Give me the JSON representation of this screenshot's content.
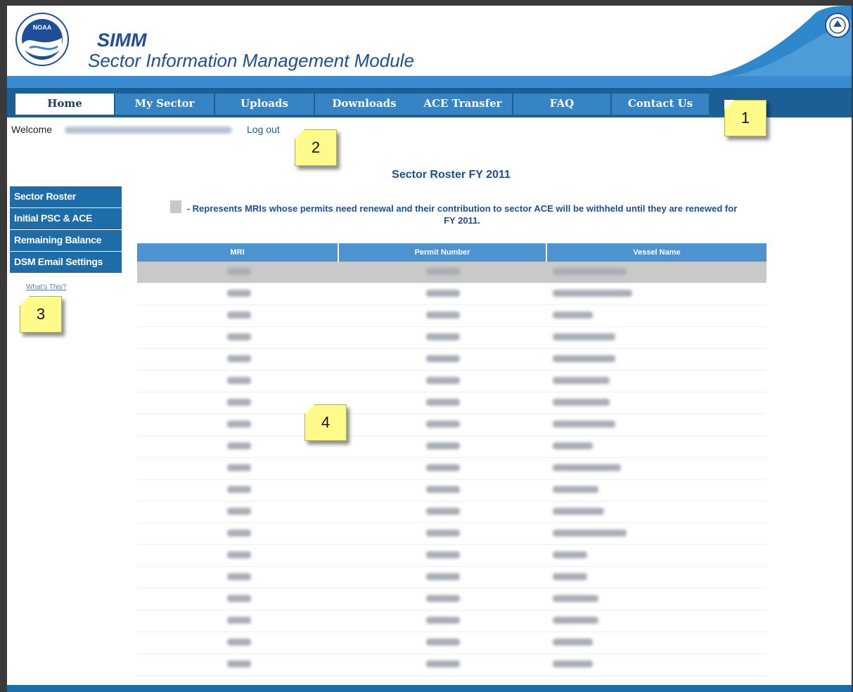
{
  "header": {
    "app_abbr": "SIMM",
    "app_title": "Sector Information Management Module",
    "logo_icon": "noaa-logo-icon",
    "seal_icon": "department-seal-icon",
    "brand_color": "#1c4f98",
    "nav_color": "#1b5f94"
  },
  "nav": {
    "tabs": [
      {
        "label": "Home",
        "active": true
      },
      {
        "label": "My Sector",
        "active": false
      },
      {
        "label": "Uploads",
        "active": false
      },
      {
        "label": "Downloads",
        "active": false
      },
      {
        "label": "ACE Transfer",
        "active": false
      },
      {
        "label": "FAQ",
        "active": false
      },
      {
        "label": "Contact Us",
        "active": false
      }
    ]
  },
  "user": {
    "welcome_label": "Welcome",
    "logout_label": "Log out"
  },
  "sidebar": {
    "items": [
      {
        "label": "Sector Roster"
      },
      {
        "label": "Initial PSC & ACE"
      },
      {
        "label": "Remaining Balance"
      },
      {
        "label": "DSM Email Settings"
      }
    ],
    "whats_this": "What's This?"
  },
  "main": {
    "title": "Sector Roster FY 2011",
    "legend_text": "- Represents MRIs whose permits need renewal and their contribution to sector ACE will be withheld until they are renewed for FY 2011.",
    "legend_swatch_color": "#c8c8c8",
    "table": {
      "columns": [
        "MRI",
        "Permit Number",
        "Vessel Name"
      ],
      "rows": [
        {
          "mri": "0011",
          "permit": "130063",
          "vessel": "KORBERTEOREM",
          "highlight": true
        },
        {
          "mri": "081",
          "permit": "011000",
          "vessel": "SEASTTOCUFILE",
          "highlight": false
        },
        {
          "mri": "070",
          "permit": "113000",
          "vessel": "CDSEBT",
          "highlight": false
        },
        {
          "mri": "089",
          "permit": "333098",
          "vessel": "CATT TRUTE",
          "highlight": false
        },
        {
          "mri": "081",
          "permit": "333307",
          "vessel": "SUSES FROM",
          "highlight": false
        },
        {
          "mri": "069",
          "permit": "320518",
          "vessel": "BALEF SEO",
          "highlight": false
        },
        {
          "mri": "701",
          "permit": "330130",
          "vessel": "C SEETLRS",
          "highlight": false
        },
        {
          "mri": "703",
          "permit": "300013",
          "vessel": "BELCTRSSEE",
          "highlight": false
        },
        {
          "mri": "704",
          "permit": "330191",
          "vessel": "UFSTET",
          "highlight": false
        },
        {
          "mri": "706",
          "permit": "330768",
          "vessel": "SEHES TASEE",
          "highlight": false
        },
        {
          "mri": "708",
          "permit": "300865",
          "vessel": "TSOFEOE",
          "highlight": false
        },
        {
          "mri": "788",
          "permit": "113960",
          "vessel": "LAST ERE",
          "highlight": false
        },
        {
          "mri": "079",
          "permit": "330073",
          "vessel": "BROOET SEDSE",
          "highlight": false
        },
        {
          "mri": "333",
          "permit": "330195",
          "vessel": "SEECR",
          "highlight": false
        },
        {
          "mri": "080",
          "permit": "136911",
          "vessel": "SELTT",
          "highlight": false
        },
        {
          "mri": "0133",
          "permit": "011608",
          "vessel": "COSRLEE",
          "highlight": false
        },
        {
          "mri": "0088",
          "permit": "330787",
          "vessel": "TR SEEB",
          "highlight": false
        },
        {
          "mri": "0089",
          "permit": "135589",
          "vessel": "SEECHI",
          "highlight": false
        },
        {
          "mri": "0087",
          "permit": "130793",
          "vessel": "COUTEE",
          "highlight": false
        }
      ]
    }
  },
  "callouts": [
    "1",
    "2",
    "3",
    "4"
  ]
}
